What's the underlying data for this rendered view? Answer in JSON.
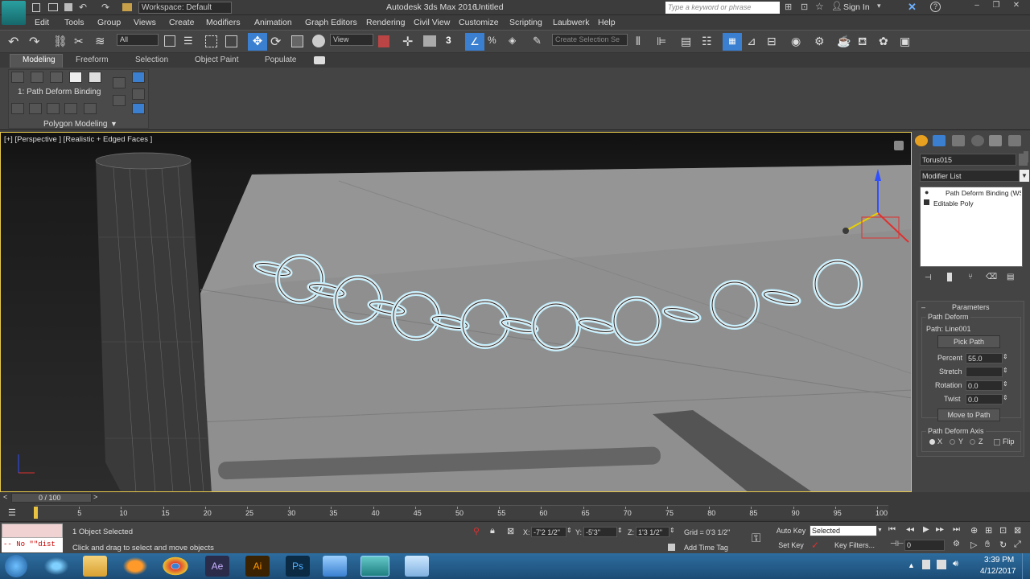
{
  "titlebar": {
    "workspace": "Workspace: Default",
    "app_title": "Autodesk 3ds Max 2016",
    "doc_title": "Untitled",
    "search_placeholder": "Type a keyword or phrase",
    "sign_in": "Sign In"
  },
  "menu": [
    "Edit",
    "Tools",
    "Group",
    "Views",
    "Create",
    "Modifiers",
    "Animation",
    "Graph Editors",
    "Rendering",
    "Civil View",
    "Customize",
    "Scripting",
    "Laubwerk",
    "Help"
  ],
  "toolbar": {
    "selection_filter": "All",
    "ref_coord": "View",
    "snap_label": "3",
    "named_selection": "Create Selection Se"
  },
  "ribbon": {
    "tabs": [
      "Modeling",
      "Freeform",
      "Selection",
      "Object Paint",
      "Populate"
    ],
    "stack_label": "1: Path Deform Binding",
    "panel_label": "Polygon Modeling"
  },
  "viewport": {
    "label": "[+] [Perspective ] [Realistic + Edged Faces ]"
  },
  "command_panel": {
    "object_name": "Torus015",
    "modifier_list": "Modifier List",
    "stack": [
      "Path Deform Binding (WS",
      "Editable Poly"
    ],
    "rollout_title": "Parameters",
    "group_title": "Path Deform",
    "path_label": "Path: Line001",
    "pick_path": "Pick Path",
    "percent_label": "Percent",
    "percent_value": "55.0",
    "stretch_label": "Stretch",
    "stretch_value": "",
    "rotation_label": "Rotation",
    "rotation_value": "0.0",
    "twist_label": "Twist",
    "twist_value": "0.0",
    "move_to_path": "Move to Path",
    "axis_group": "Path Deform Axis",
    "axis_x": "X",
    "axis_y": "Y",
    "axis_z": "Z",
    "flip": "Flip"
  },
  "timeline": {
    "frame_display": "0 / 100",
    "ticks": [
      "5",
      "10",
      "15",
      "20",
      "25",
      "30",
      "35",
      "40",
      "45",
      "50",
      "55",
      "60",
      "65",
      "70",
      "75",
      "80",
      "85",
      "90",
      "95",
      "100"
    ]
  },
  "status": {
    "script_line": "-- No \"\"dist",
    "selected_count": "1 Object Selected",
    "prompt": "Click and drag to select and move objects",
    "x_label": "X:",
    "x_value": "-7'2 1/2\"",
    "y_label": "Y:",
    "y_value": "-5'3\"",
    "z_label": "Z:",
    "z_value": "1'3 1/2\"",
    "grid": "Grid = 0'3 1/2\"",
    "add_time_tag": "Add Time Tag",
    "auto_key": "Auto Key",
    "set_key": "Set Key",
    "selected_dropdown": "Selected",
    "key_filters": "Key Filters...",
    "frame_field": "0"
  },
  "taskbar": {
    "time": "3:39 PM",
    "date": "4/12/2017"
  },
  "colors": {
    "viewport_border": "#e6c84c",
    "selection_glow": "#bfefff",
    "accent_blue": "#3a7fd0"
  }
}
